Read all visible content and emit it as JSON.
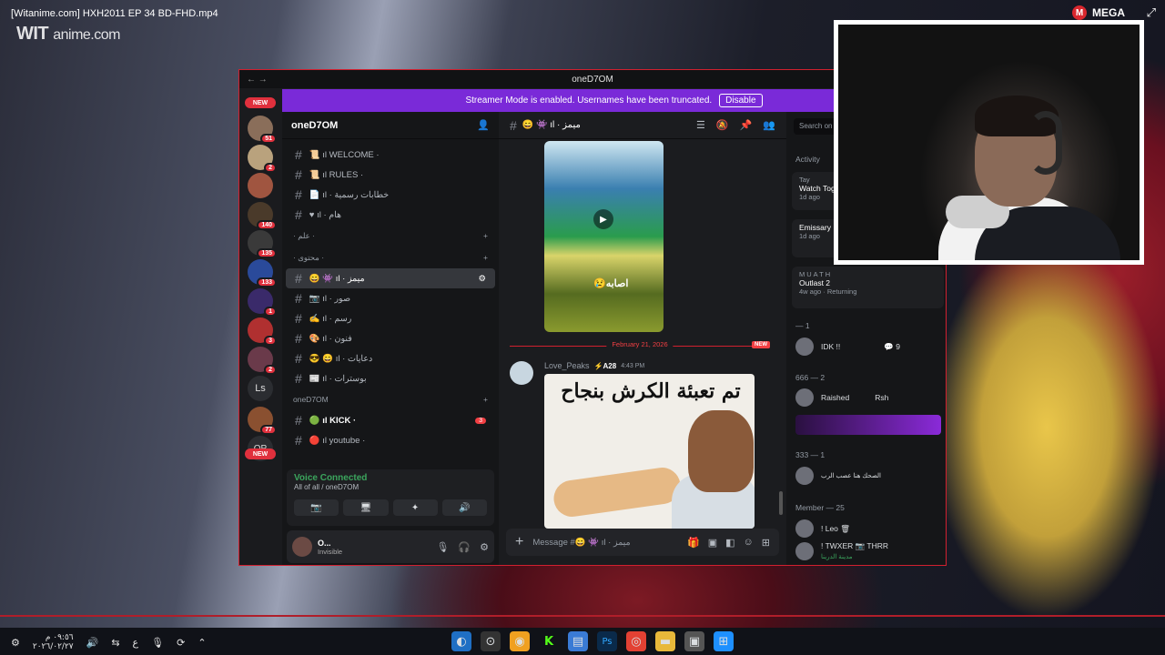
{
  "video": {
    "title": "[Witanime.com] HXH2011 EP 34 BD-FHD.mp4",
    "watermark_a": "WIT",
    "watermark_b": "anime.com",
    "brand": "MEGA"
  },
  "discord": {
    "window_title": "oneD7OM",
    "banner": {
      "text": "Streamer Mode is enabled. Usernames have been truncated.",
      "button": "Disable"
    },
    "server_badges": [
      "NEW",
      "51",
      "2",
      "140",
      "135",
      "133",
      "1",
      "3",
      "2",
      "77",
      "NEW"
    ],
    "server_letters": [
      "Ls",
      "OP"
    ],
    "server_name": "oneD7OM",
    "channels_top": [
      "📜 ıl WELCOME ·",
      "📜 ıl RULES ·",
      "📄 ıl · خطابات رسمية",
      "♥ ıl · هام"
    ],
    "cat1": "· علم ·",
    "cat2": "· محتوى ·",
    "channels_mid": [
      "😄 👾 ıl · ميمز",
      "📷 ıl · صور",
      "✍ ıl · رسم",
      "🎨 ıl · فنون",
      "😎 😄 ıl · دعايات",
      "📰 ıl · بوسترات"
    ],
    "cat3": "oneD7OM",
    "channels_bottom": [
      "🟢 ıl KICK ·",
      "🔴 ıl youtube ·"
    ],
    "kick_badge": "3",
    "voice": {
      "status": "Voice Connected",
      "sub": "All of all / oneD7OM"
    },
    "user": {
      "name": "O...",
      "status": "Invisible"
    },
    "chat": {
      "header": "😄 👾 ıl · ميمز",
      "video_caption": "😢اصابه",
      "date": "February 21, 2026",
      "new": "NEW",
      "author": "Love_Peaks",
      "tag": "⚡A28",
      "time": "4:43 PM",
      "meme_text": "تم تعبئة الكرش بنجاح",
      "composer": "Message #😄 👾 ıl · ميمز"
    },
    "members": {
      "search": "Search on",
      "activity": "Activity",
      "acts": [
        {
          "name": "Tay",
          "title": "Watch Tog",
          "time": "1d ago"
        },
        {
          "name": "",
          "title": "Emissary",
          "time": "1d ago"
        },
        {
          "name": "MUATH",
          "title": "Outlast 2",
          "time": "4w ago",
          "extra": "Returning"
        }
      ],
      "groups": [
        {
          "label": "— 1",
          "top": "IDK !!",
          "badge": "💬 9"
        },
        {
          "label": "666 — 2",
          "members": [
            "Raished",
            "Rsh"
          ]
        },
        {
          "label": "333 — 1",
          "member": "الصحك هنا عصب الرب"
        },
        {
          "label": "Member — 25",
          "members": [
            "! Leo 🗑",
            "! TWXER 📷 THRR",
            "مدينة الدرينا"
          ]
        }
      ]
    }
  },
  "taskbar": {
    "clock_time": "٠٩:٥٦ م",
    "clock_date": "٢٠٢٦/٠٢/٢٧",
    "lang": "ع"
  },
  "colors": {
    "accent": "#d1202f",
    "streamer": "#7a2ad8",
    "voice": "#3ba55d"
  }
}
